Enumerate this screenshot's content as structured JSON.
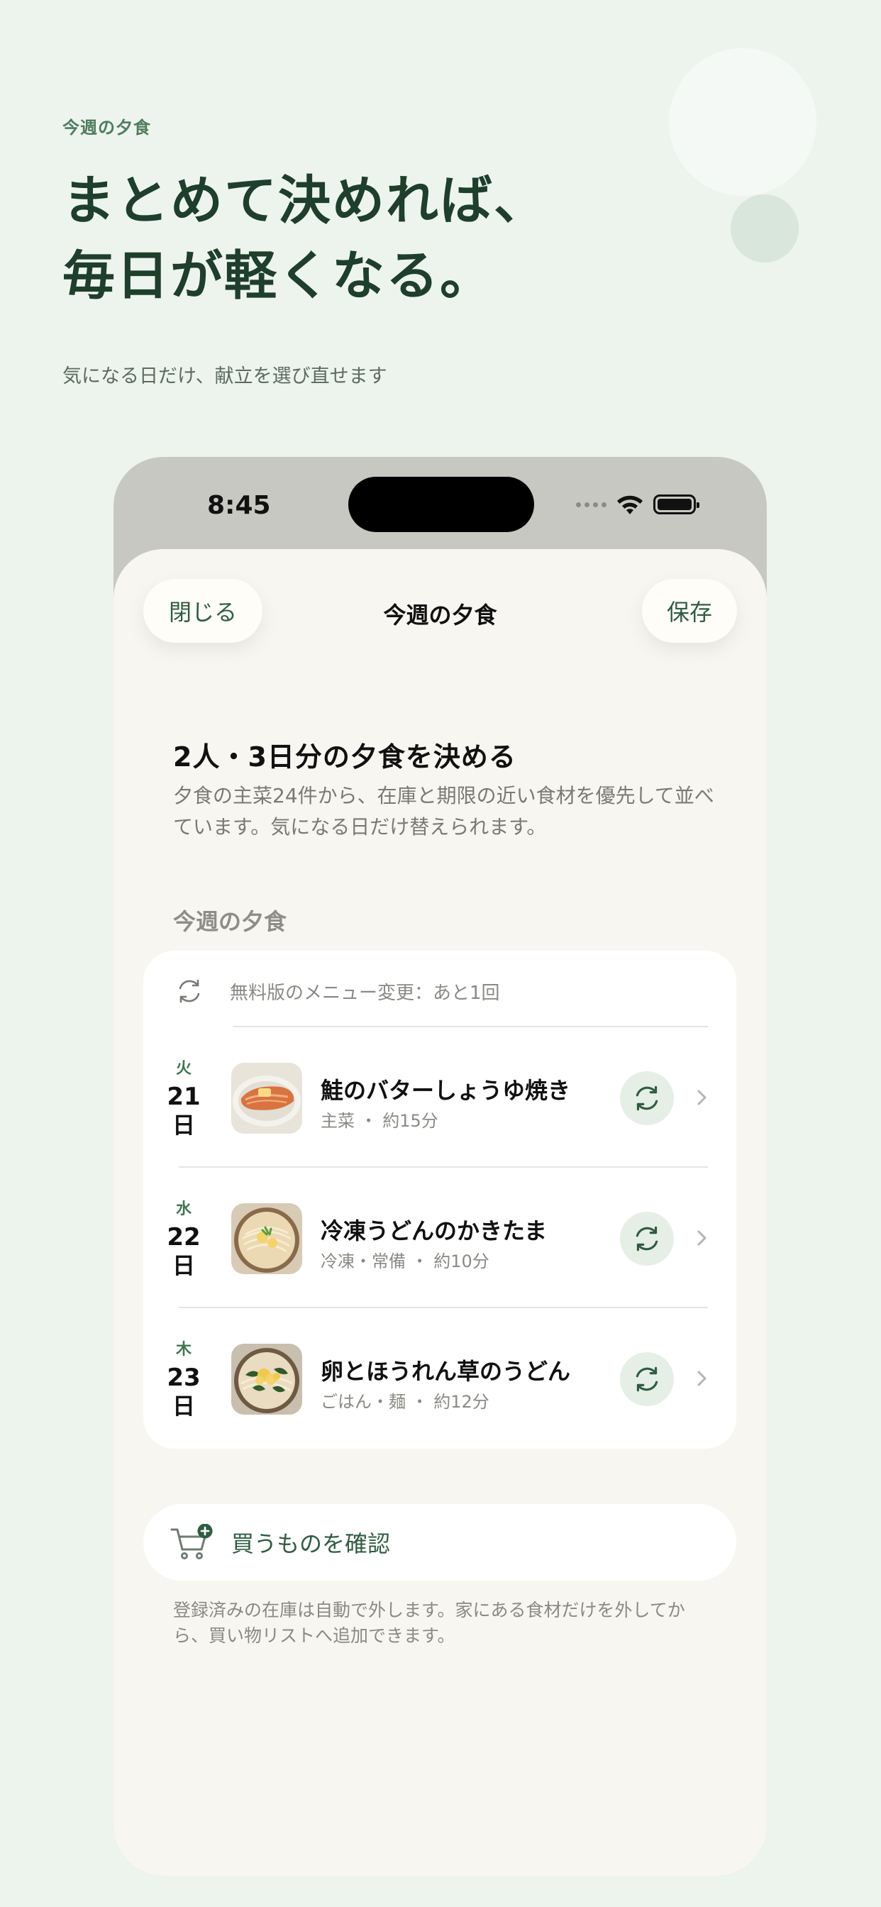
{
  "promo": {
    "eyebrow": "今週の夕食",
    "headline_line1": "まとめて決めれば、",
    "headline_line2": "毎日が軽くなる。",
    "subtitle": "気になる日だけ、献立を選び直せます"
  },
  "status_bar": {
    "time": "8:45",
    "icons": [
      "signal-icon",
      "wifi-icon",
      "battery-icon"
    ]
  },
  "nav": {
    "close_label": "閉じる",
    "title": "今週の夕食",
    "save_label": "保存"
  },
  "intro": {
    "title": "2人・3日分の夕食を決める",
    "description": "夕食の主菜24件から、在庫と期限の近い食材を優先して並べています。気になる日だけ替えられます。"
  },
  "section": {
    "label": "今週の夕食"
  },
  "quota": {
    "text": "無料版のメニュー変更：あと1回",
    "icon": "refresh-icon"
  },
  "meals": [
    {
      "weekday": "火",
      "day": "21",
      "unit": "日",
      "name": "鮭のバターしょうゆ焼き",
      "meta": "主菜 ・ 約15分",
      "thumb": "salmon"
    },
    {
      "weekday": "水",
      "day": "22",
      "unit": "日",
      "name": "冷凍うどんのかきたま",
      "meta": "冷凍・常備 ・ 約10分",
      "thumb": "udon"
    },
    {
      "weekday": "木",
      "day": "23",
      "unit": "日",
      "name": "卵とほうれん草のうどん",
      "meta": "ごはん・麺 ・ 約12分",
      "thumb": "spinach-udon"
    }
  ],
  "shopping": {
    "label": "買うものを確認",
    "icon": "cart-add-icon",
    "note": "登録済みの在庫は自動で外します。家にある食材だけを外してから、買い物リストへ追加できます。"
  },
  "colors": {
    "background": "#edf4ed",
    "accent": "#2f5d41",
    "headline": "#1d3f2b",
    "sheet": "#f8f6f1",
    "swap_button_bg": "#e5efe6"
  }
}
